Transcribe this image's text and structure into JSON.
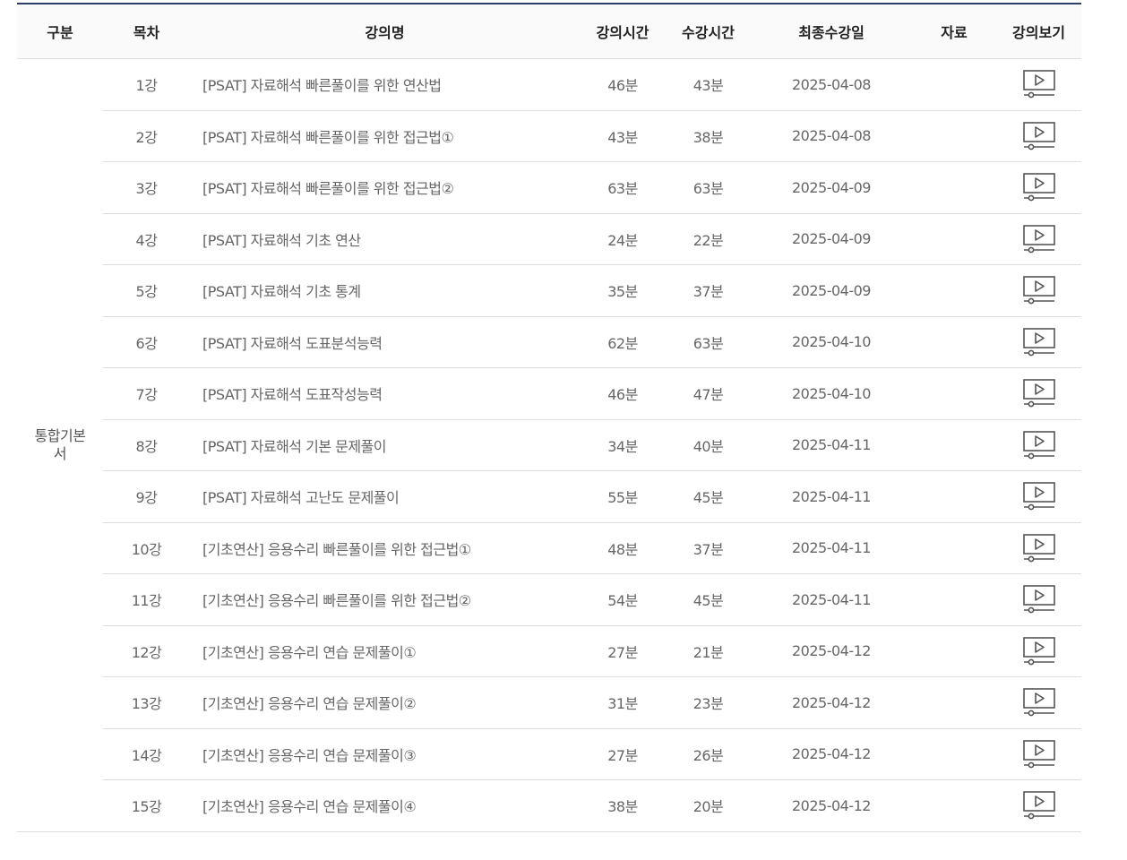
{
  "table": {
    "headers": {
      "category": "구분",
      "index": "목차",
      "title": "강의명",
      "lecture_time": "강의시간",
      "watch_time": "수강시간",
      "last_date": "최종수강일",
      "materials": "자료",
      "view": "강의보기"
    },
    "category_label": "통합기본서",
    "rows": [
      {
        "index": "1강",
        "title": "[PSAT] 자료해석 빠른풀이를 위한 연산법",
        "lecture_time": "46분",
        "watch_time": "43분",
        "last_date": "2025-04-08"
      },
      {
        "index": "2강",
        "title": "[PSAT] 자료해석 빠른풀이를 위한 접근법①",
        "lecture_time": "43분",
        "watch_time": "38분",
        "last_date": "2025-04-08"
      },
      {
        "index": "3강",
        "title": "[PSAT] 자료해석 빠른풀이를 위한 접근법②",
        "lecture_time": "63분",
        "watch_time": "63분",
        "last_date": "2025-04-09"
      },
      {
        "index": "4강",
        "title": "[PSAT] 자료해석 기초 연산",
        "lecture_time": "24분",
        "watch_time": "22분",
        "last_date": "2025-04-09"
      },
      {
        "index": "5강",
        "title": "[PSAT] 자료해석 기초 통계",
        "lecture_time": "35분",
        "watch_time": "37분",
        "last_date": "2025-04-09"
      },
      {
        "index": "6강",
        "title": "[PSAT] 자료해석 도표분석능력",
        "lecture_time": "62분",
        "watch_time": "63분",
        "last_date": "2025-04-10"
      },
      {
        "index": "7강",
        "title": "[PSAT] 자료해석 도표작성능력",
        "lecture_time": "46분",
        "watch_time": "47분",
        "last_date": "2025-04-10"
      },
      {
        "index": "8강",
        "title": "[PSAT] 자료해석 기본 문제풀이",
        "lecture_time": "34분",
        "watch_time": "40분",
        "last_date": "2025-04-11"
      },
      {
        "index": "9강",
        "title": "[PSAT] 자료해석 고난도 문제풀이",
        "lecture_time": "55분",
        "watch_time": "45분",
        "last_date": "2025-04-11"
      },
      {
        "index": "10강",
        "title": "[기초연산] 응용수리 빠른풀이를 위한 접근법①",
        "lecture_time": "48분",
        "watch_time": "37분",
        "last_date": "2025-04-11"
      },
      {
        "index": "11강",
        "title": "[기초연산] 응용수리 빠른풀이를 위한 접근법②",
        "lecture_time": "54분",
        "watch_time": "45분",
        "last_date": "2025-04-11"
      },
      {
        "index": "12강",
        "title": "[기초연산] 응용수리 연습 문제풀이①",
        "lecture_time": "27분",
        "watch_time": "21분",
        "last_date": "2025-04-12"
      },
      {
        "index": "13강",
        "title": "[기초연산] 응용수리 연습 문제풀이②",
        "lecture_time": "31분",
        "watch_time": "23분",
        "last_date": "2025-04-12"
      },
      {
        "index": "14강",
        "title": "[기초연산] 응용수리 연습 문제풀이③",
        "lecture_time": "27분",
        "watch_time": "26분",
        "last_date": "2025-04-12"
      },
      {
        "index": "15강",
        "title": "[기초연산] 응용수리 연습 문제풀이④",
        "lecture_time": "38분",
        "watch_time": "20분",
        "last_date": "2025-04-12"
      }
    ],
    "view_icon": "video-play-icon",
    "colors": {
      "header_border": "#2b3f6b",
      "row_border": "#dddddd",
      "icon": "#555555"
    }
  }
}
